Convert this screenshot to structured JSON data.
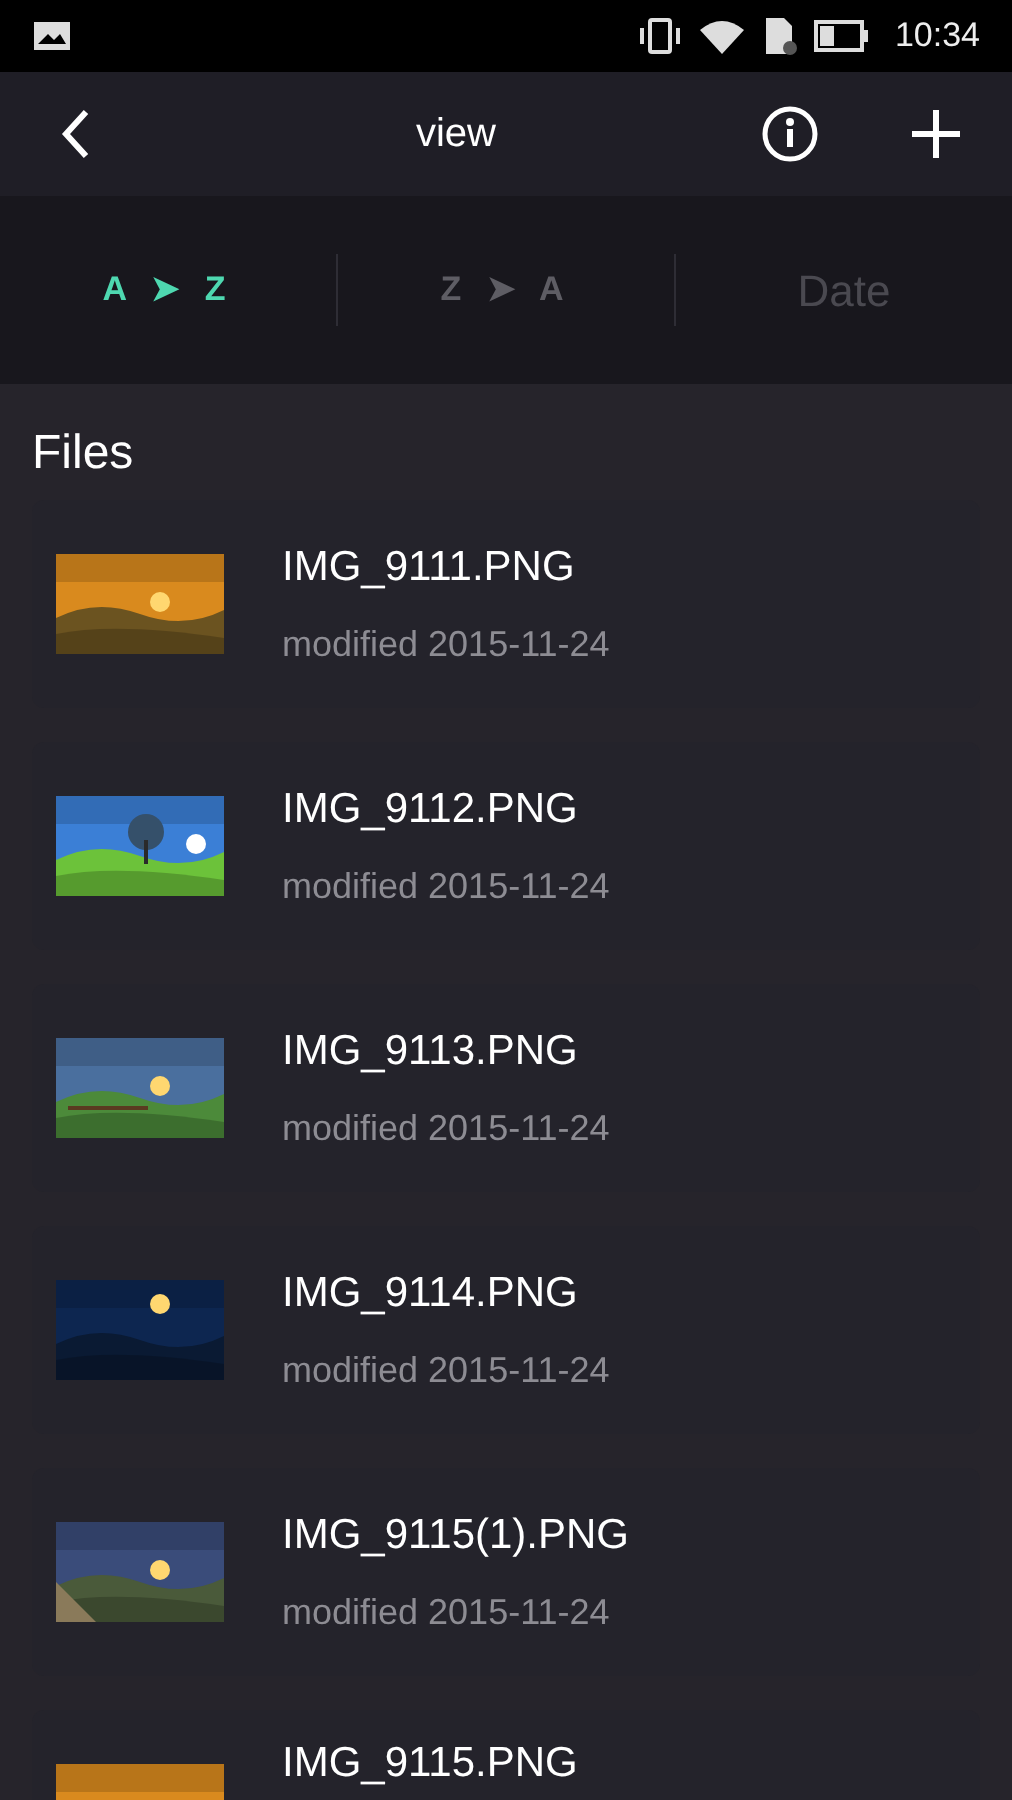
{
  "status_bar": {
    "time": "10:34"
  },
  "header": {
    "title": "view"
  },
  "sort_tabs": [
    {
      "label": "A ➤ Z",
      "selected": true,
      "disabled": false
    },
    {
      "label": "Z ➤ A",
      "selected": false,
      "disabled": false
    },
    {
      "label": "Date",
      "selected": false,
      "disabled": true
    }
  ],
  "section_title": "Files",
  "files": [
    {
      "name": "IMG_9111.PNG",
      "modified": "modified 2015-11-24"
    },
    {
      "name": "IMG_9112.PNG",
      "modified": "modified 2015-11-24"
    },
    {
      "name": "IMG_9113.PNG",
      "modified": "modified 2015-11-24"
    },
    {
      "name": "IMG_9114.PNG",
      "modified": "modified 2015-11-24"
    },
    {
      "name": "IMG_9115(1).PNG",
      "modified": "modified 2015-11-24"
    },
    {
      "name": "IMG_9115.PNG"
    }
  ]
}
